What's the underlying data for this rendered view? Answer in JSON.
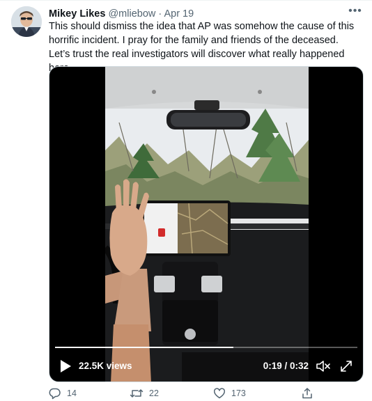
{
  "tweet": {
    "author_name": "Mikey Likes",
    "handle": "@mliebow",
    "separator": "·",
    "time": "Apr 19",
    "more": "•••",
    "text": "This should dismiss the idea that AP was somehow the cause of this horrific incident. I pray for the family and friends of the deceased. Let’s trust the real investigators will discover what really happened here."
  },
  "video": {
    "views": "22.5K views",
    "timecode": "0:19 / 0:32",
    "progress": 0.59
  },
  "actions": {
    "replies": "14",
    "retweets": "22",
    "likes": "173"
  },
  "icons": {
    "more": "more-icon",
    "play": "play-icon",
    "volume": "volume-icon",
    "expand": "expand-icon",
    "reply": "reply-icon",
    "retweet": "retweet-icon",
    "like": "like-icon",
    "share": "share-icon"
  },
  "colors": {
    "text": "#0f1419",
    "secondary": "#536471",
    "border": "#cfd9de"
  }
}
